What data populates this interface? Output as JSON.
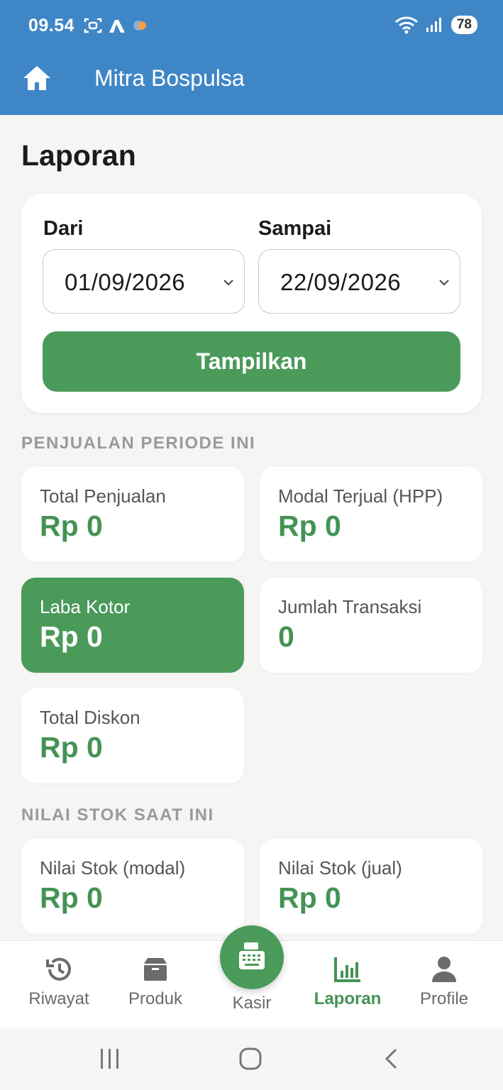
{
  "status_bar": {
    "time": "09.54",
    "battery": "78"
  },
  "app_bar": {
    "title": "Mitra Bospulsa",
    "home_icon": "home-icon"
  },
  "page": {
    "title": "Laporan"
  },
  "filter": {
    "from_label": "Dari",
    "from_value": "01/09/2026",
    "to_label": "Sampai",
    "to_value": "22/09/2026",
    "submit_label": "Tampilkan"
  },
  "sales_section": {
    "title": "PENJUALAN PERIODE INI",
    "cards": [
      {
        "label": "Total Penjualan",
        "value": "Rp 0"
      },
      {
        "label": "Modal Terjual (HPP)",
        "value": "Rp 0"
      },
      {
        "label": "Laba Kotor",
        "value": "Rp 0"
      },
      {
        "label": "Jumlah Transaksi",
        "value": "0"
      },
      {
        "label": "Total Diskon",
        "value": "Rp 0"
      }
    ]
  },
  "stock_section": {
    "title": "NILAI STOK SAAT INI",
    "cards": [
      {
        "label": "Nilai Stok (modal)",
        "value": "Rp 0"
      },
      {
        "label": "Nilai Stok (jual)",
        "value": "Rp 0"
      }
    ]
  },
  "bottom_nav": {
    "items": [
      {
        "label": "Riwayat",
        "icon": "history-icon"
      },
      {
        "label": "Produk",
        "icon": "box-icon"
      },
      {
        "label": "Kasir",
        "icon": "cash-register-icon"
      },
      {
        "label": "Laporan",
        "icon": "bar-chart-icon"
      },
      {
        "label": "Profile",
        "icon": "person-icon"
      }
    ],
    "active": "Laporan"
  },
  "colors": {
    "primary_blue": "#3f86c6",
    "accent_green": "#4a9a5a",
    "value_green": "#449355"
  }
}
